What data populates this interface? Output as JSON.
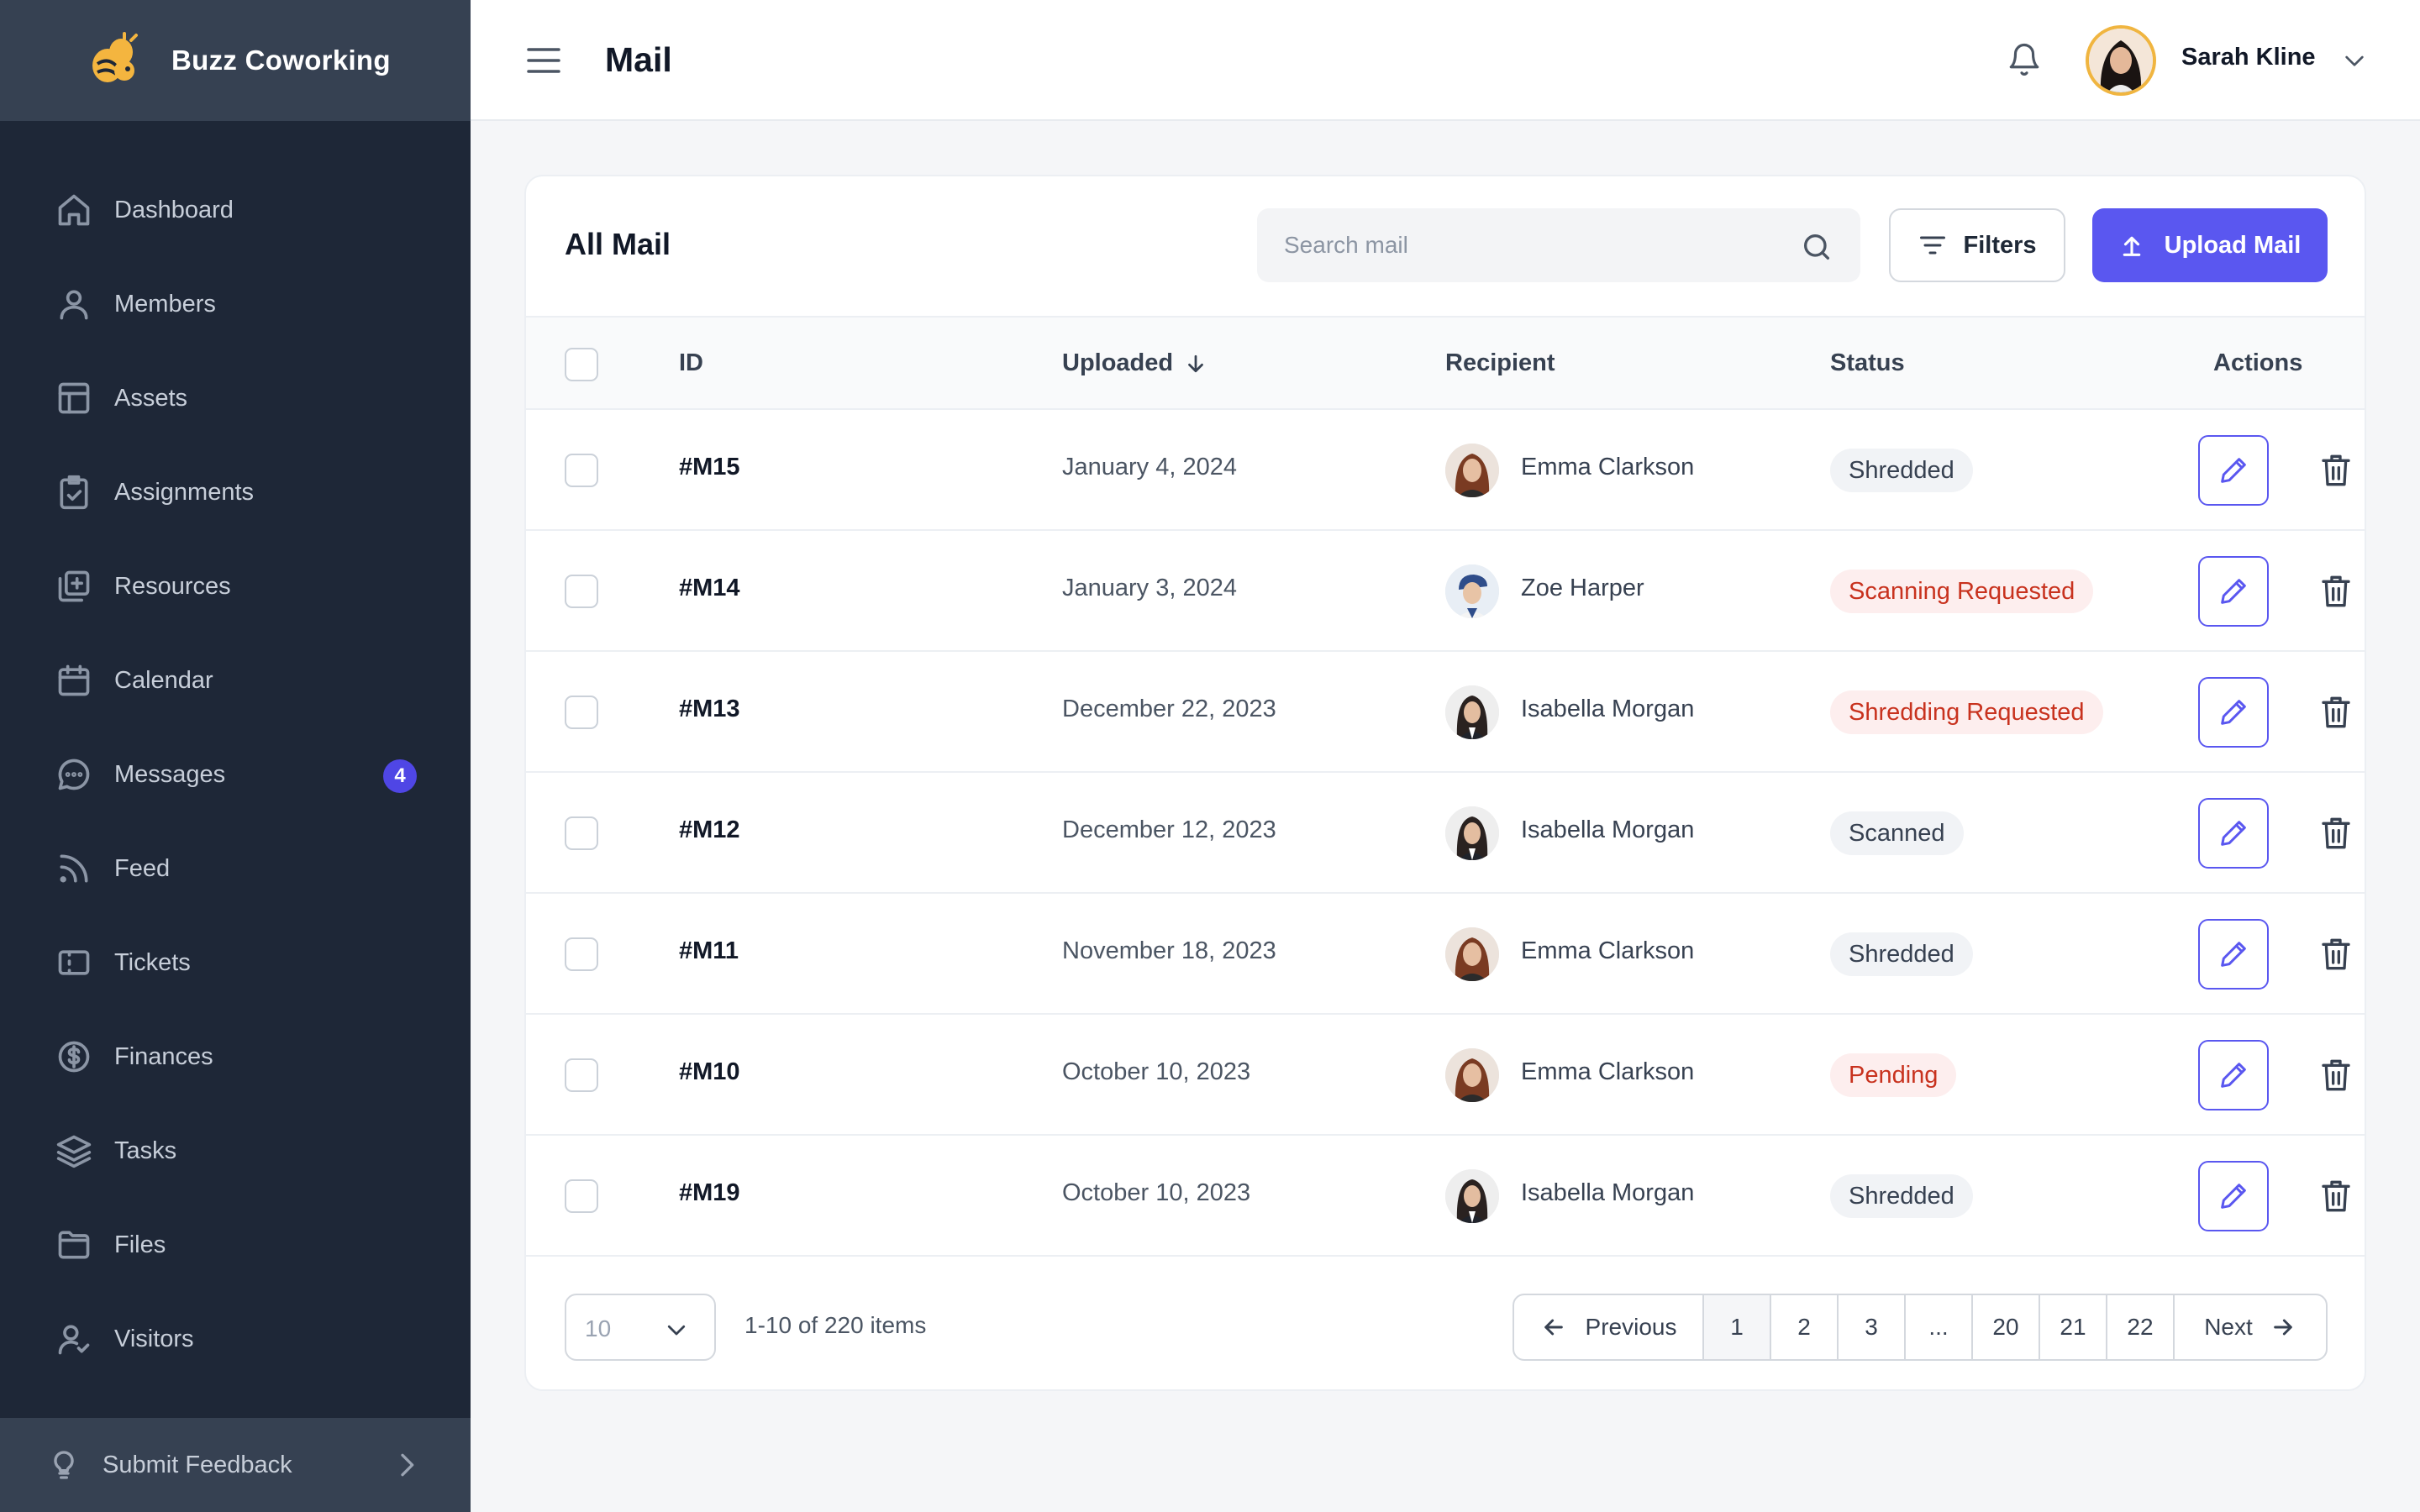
{
  "brand": {
    "name": "Buzz Coworking",
    "logo_icon": "bee-logo-icon"
  },
  "sidebar": {
    "items": [
      {
        "label": "Dashboard",
        "icon": "home-icon"
      },
      {
        "label": "Members",
        "icon": "user-icon"
      },
      {
        "label": "Assets",
        "icon": "layout-icon"
      },
      {
        "label": "Assignments",
        "icon": "clipboard-check-icon"
      },
      {
        "label": "Resources",
        "icon": "add-stack-icon"
      },
      {
        "label": "Calendar",
        "icon": "calendar-icon"
      },
      {
        "label": "Messages",
        "icon": "chat-icon",
        "badge": "4"
      },
      {
        "label": "Feed",
        "icon": "rss-icon"
      },
      {
        "label": "Tickets",
        "icon": "ticket-icon"
      },
      {
        "label": "Finances",
        "icon": "dollar-icon"
      },
      {
        "label": "Tasks",
        "icon": "layers-icon"
      },
      {
        "label": "Files",
        "icon": "folder-icon"
      },
      {
        "label": "Visitors",
        "icon": "user-check-icon"
      }
    ],
    "feedback_label": "Submit Feedback"
  },
  "header": {
    "title": "Mail",
    "user_name": "Sarah Kline"
  },
  "card": {
    "title": "All Mail",
    "search_placeholder": "Search mail",
    "filters_label": "Filters",
    "upload_label": "Upload Mail"
  },
  "table": {
    "columns": {
      "id": "ID",
      "uploaded": "Uploaded",
      "recipient": "Recipient",
      "status": "Status",
      "actions": "Actions"
    },
    "rows": [
      {
        "id": "#M15",
        "date": "January 4, 2024",
        "recipient": "Emma Clarkson",
        "status": "Shredded"
      },
      {
        "id": "#M14",
        "date": "January 3, 2024",
        "recipient": "Zoe Harper",
        "status": "Scanning Requested"
      },
      {
        "id": "#M13",
        "date": "December 22, 2023",
        "recipient": "Isabella Morgan",
        "status": "Shredding Requested"
      },
      {
        "id": "#M12",
        "date": "December 12, 2023",
        "recipient": "Isabella Morgan",
        "status": "Scanned"
      },
      {
        "id": "#M11",
        "date": "November 18, 2023",
        "recipient": "Emma Clarkson",
        "status": "Shredded"
      },
      {
        "id": "#M10",
        "date": "October 10, 2023",
        "recipient": "Emma Clarkson",
        "status": "Pending"
      },
      {
        "id": "#M19",
        "date": "October 10, 2023",
        "recipient": "Isabella Morgan",
        "status": "Shredded"
      }
    ]
  },
  "pagination": {
    "per_page": "10",
    "items_text": "1-10 of 220 items",
    "previous_label": "Previous",
    "next_label": "Next",
    "pages": [
      "1",
      "2",
      "3",
      "...",
      "20",
      "21",
      "22"
    ],
    "current_page": "1"
  },
  "colors": {
    "sidebar_bg": "#1e2737",
    "brand_bg": "#364152",
    "accent": "#5a57f0",
    "badge_danger_text": "#c8321e",
    "badge_danger_bg": "#fdeeee",
    "badge_neutral_bg": "#f1f3f6"
  }
}
